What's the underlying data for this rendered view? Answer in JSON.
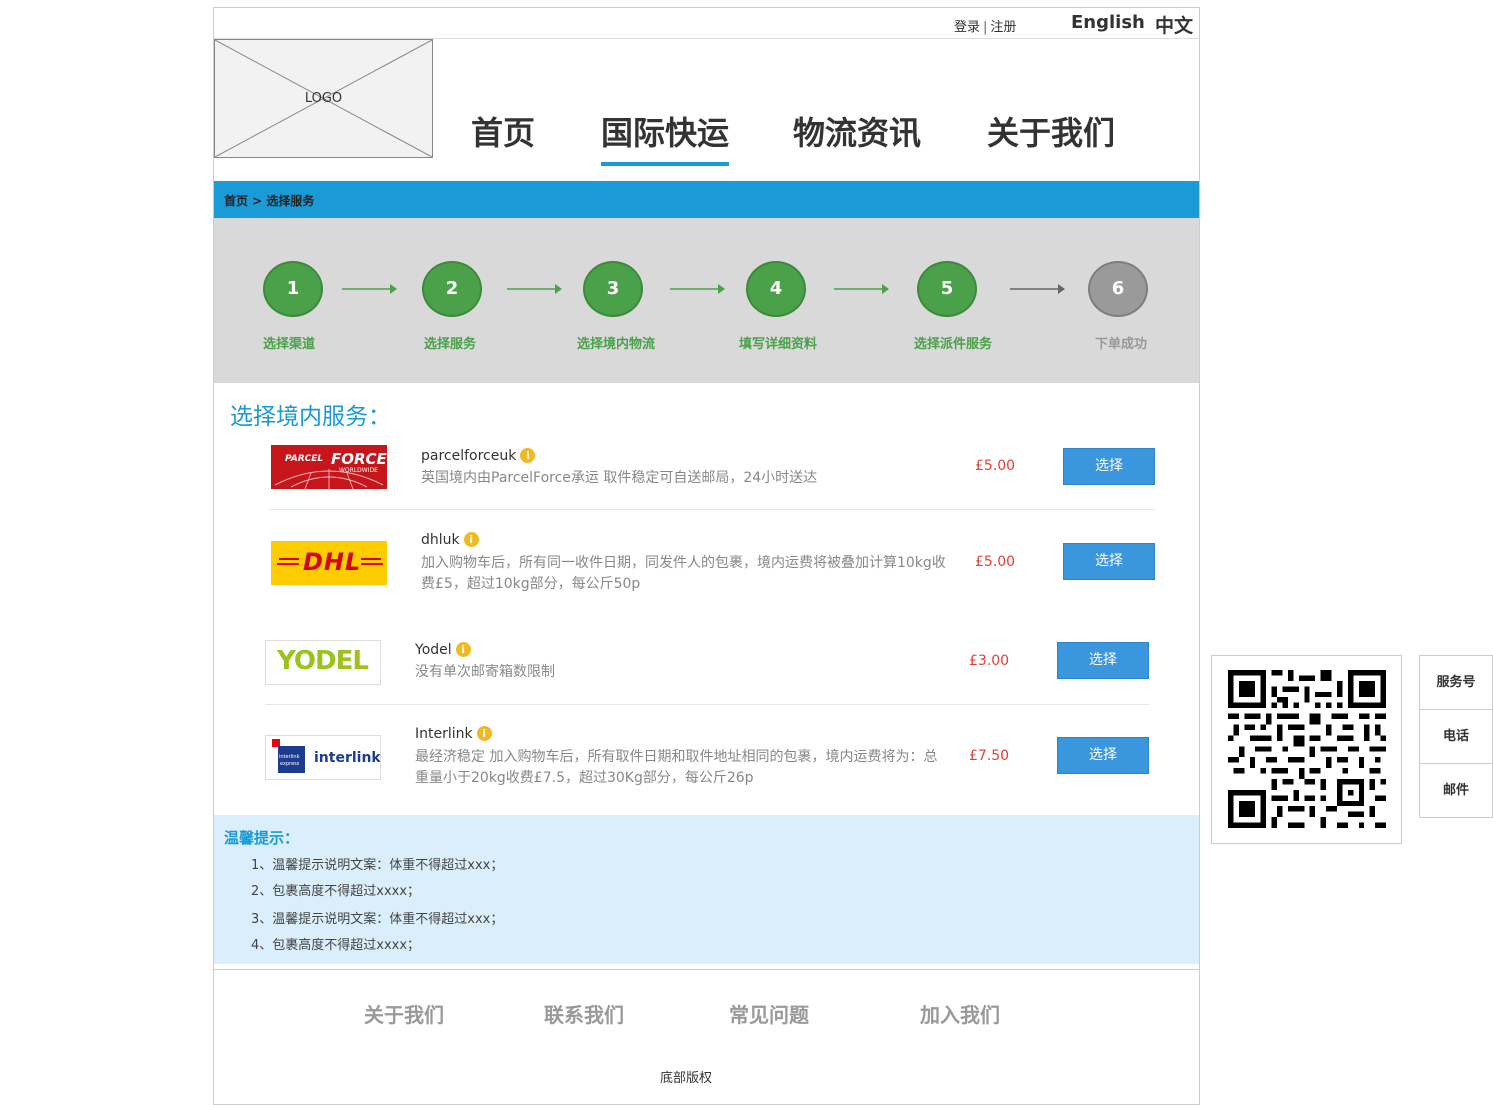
{
  "topbar": {
    "login": "登录",
    "separator": "|",
    "register": "注册",
    "lang_en": "English",
    "lang_zh": "中文"
  },
  "logo": {
    "text": "LOGO"
  },
  "nav": [
    {
      "label": "首页",
      "active": false
    },
    {
      "label": "国际快运",
      "active": true
    },
    {
      "label": "物流资讯",
      "active": false
    },
    {
      "label": "关于我们",
      "active": false
    }
  ],
  "breadcrumb": {
    "text": "首页 > 选择服务"
  },
  "steps": [
    {
      "num": "1",
      "label": "选择渠道",
      "done": true
    },
    {
      "num": "2",
      "label": "选择服务",
      "done": true
    },
    {
      "num": "3",
      "label": "选择境内物流",
      "done": true
    },
    {
      "num": "4",
      "label": "填写详细资料",
      "done": true
    },
    {
      "num": "5",
      "label": "选择派件服务",
      "done": true
    },
    {
      "num": "6",
      "label": "下单成功",
      "done": false
    }
  ],
  "section_title": "选择境内服务：",
  "services": [
    {
      "name": "parcelforceuk",
      "logo": "parcelforce-logo",
      "desc": "英国境内由ParcelForce承运 取件稳定可自送邮局，24小时送达",
      "price": "£5.00",
      "button": "选择"
    },
    {
      "name": "dhluk",
      "logo": "dhl-logo",
      "desc": "加入购物车后，所有同一收件日期，同发件人的包裹，境内运费将被叠加计算10kg收费£5，超过10kg部分，每公斤50p",
      "price": "£5.00",
      "button": "选择"
    },
    {
      "name": "Yodel",
      "logo": "yodel-logo",
      "desc": "没有单次邮寄箱数限制",
      "price": "£3.00",
      "button": "选择"
    },
    {
      "name": "Interlink",
      "logo": "interlink-logo",
      "desc": "最经济稳定 加入购物车后，所有取件日期和取件地址相同的包裹，境内运费将为：总重量小于20kg收费£7.5，超过30Kg部分，每公斤26p",
      "price": "£7.50",
      "button": "选择"
    }
  ],
  "logos": {
    "parcelforce": {
      "line1": "PARCEL",
      "line2": "FORCE",
      "line3": "WORLDWIDE"
    },
    "dhl": {
      "text": "DHL"
    },
    "yodel": {
      "text": "YODEL"
    },
    "interlink": {
      "badge1": "interlink",
      "badge2": "express",
      "text": "interlink"
    }
  },
  "tips": {
    "title": "温馨提示：",
    "items": [
      "1、温馨提示说明文案：体重不得超过xxx；",
      "2、包裹高度不得超过xxxx；",
      "3、温馨提示说明文案：体重不得超过xxx；",
      "4、包裹高度不得超过xxxx；"
    ]
  },
  "footer": {
    "links": [
      "关于我们",
      "联系我们",
      "常见问题",
      "加入我们"
    ],
    "copyright": "底部版权"
  },
  "side_menu": [
    "服务号",
    "电话",
    "邮件"
  ],
  "colors": {
    "accent": "#1a9ad6",
    "step_green": "#4aa14a",
    "price_red": "#e0403a",
    "button_blue": "#3a96dd",
    "tips_bg": "#dbeefc"
  }
}
